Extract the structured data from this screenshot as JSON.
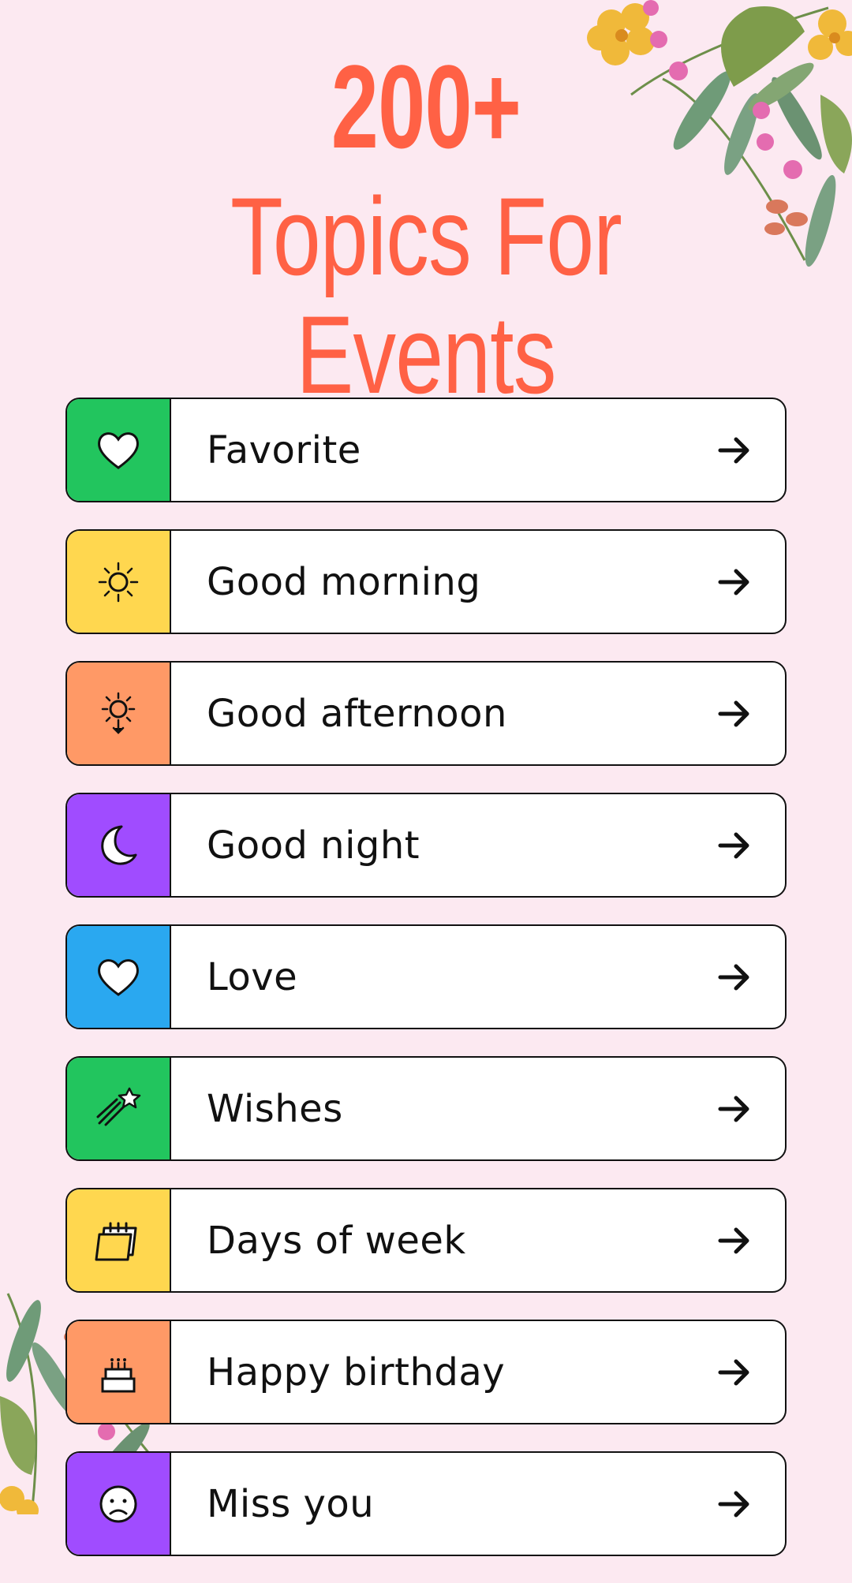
{
  "header": {
    "number": "200+",
    "title": "Topics For Events"
  },
  "topics": [
    {
      "label": "Favorite",
      "icon": "heart-icon",
      "color": "#22c55e"
    },
    {
      "label": "Good morning",
      "icon": "sun-icon",
      "color": "#ffd74f"
    },
    {
      "label": "Good afternoon",
      "icon": "sunset-icon",
      "color": "#ff9966"
    },
    {
      "label": "Good night",
      "icon": "moon-icon",
      "color": "#a04cff"
    },
    {
      "label": "Love",
      "icon": "heart-icon",
      "color": "#2aa8f0"
    },
    {
      "label": "Wishes",
      "icon": "shooting-star-icon",
      "color": "#22c55e"
    },
    {
      "label": "Days of week",
      "icon": "calendar-icon",
      "color": "#ffd74f"
    },
    {
      "label": "Happy birthday",
      "icon": "cake-icon",
      "color": "#ff9966"
    },
    {
      "label": "Miss you",
      "icon": "sad-face-icon",
      "color": "#a04cff"
    }
  ],
  "colors": {
    "background": "#fce9f1",
    "accent": "#ff6145"
  }
}
